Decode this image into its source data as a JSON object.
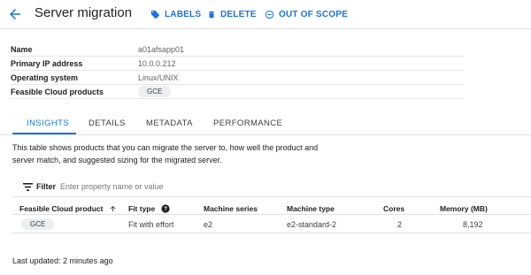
{
  "header": {
    "title": "Server migration",
    "back_icon": "arrow-left-icon",
    "actions": [
      {
        "label": "LABELS",
        "icon": "label-icon"
      },
      {
        "label": "DELETE",
        "icon": "trash-icon"
      },
      {
        "label": "OUT OF SCOPE",
        "icon": "minus-circle-icon"
      }
    ],
    "accent_color": "#1a73e8"
  },
  "properties": [
    {
      "key": "Name",
      "value": "a01afsapp01"
    },
    {
      "key": "Primary IP address",
      "value": "10.0.0.212"
    },
    {
      "key": "Operating system",
      "value": "Linux/UNIX"
    },
    {
      "key": "Feasible Cloud products",
      "value": "GCE"
    }
  ],
  "tabs": [
    "INSIGHTS",
    "DETAILS",
    "METADATA",
    "PERFORMANCE"
  ],
  "active_tab": "INSIGHTS",
  "description": "This table shows products that you can migrate the server to, how well the product and server match, and suggested sizing for the migrated server.",
  "filter": {
    "label": "Filter",
    "placeholder": "Enter property name or value"
  },
  "table": {
    "columns": [
      "Feasible Cloud product",
      "Fit type",
      "Machine series",
      "Machine type",
      "Cores",
      "Memory (MB)"
    ],
    "sort_column": "Feasible Cloud product",
    "sort_direction": "ascending",
    "rows": [
      {
        "product": "GCE",
        "fit_type": "Fit with effort",
        "machine_series": "e2",
        "machine_type": "e2-standard-2",
        "cores": "2",
        "memory": "8,192"
      }
    ]
  },
  "footer": {
    "last_updated": "Last updated: 2 minutes ago"
  }
}
